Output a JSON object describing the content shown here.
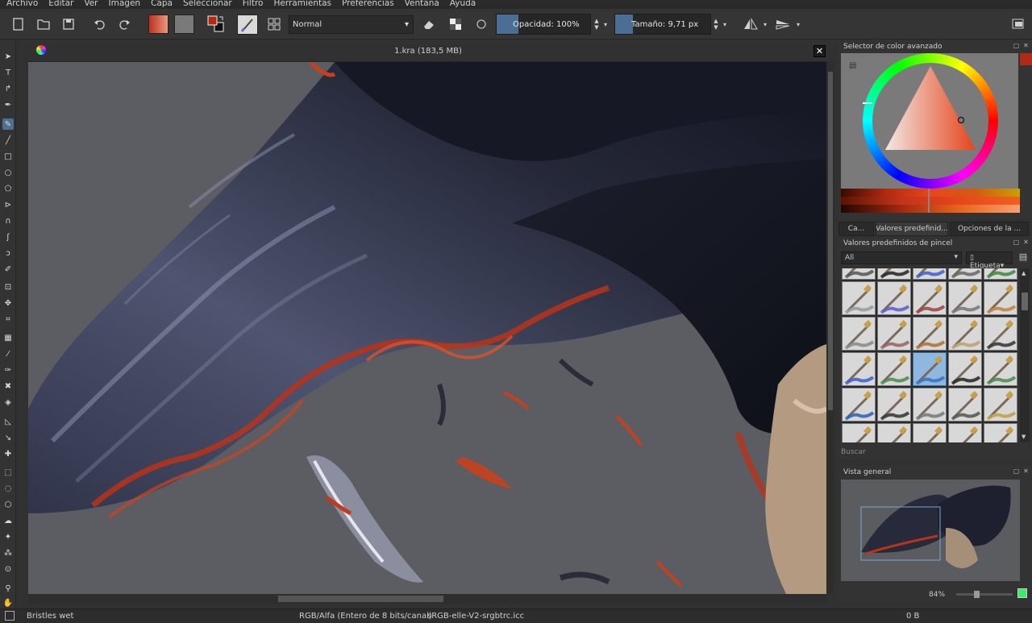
{
  "menu": [
    "Archivo",
    "Editar",
    "Ver",
    "Imagen",
    "Capa",
    "Seleccionar",
    "Filtro",
    "Herramientas",
    "Preferencias",
    "Ventana",
    "Ayuda"
  ],
  "toolbar": {
    "blend_mode": "Normal",
    "opacity_label": "Opacidad:",
    "opacity_value": "100%",
    "opacity_fraction": 0.23,
    "size_label": "Tamaño:",
    "size_value": "9,71 px",
    "size_fraction": 0.19,
    "fg_color": "#b22a14",
    "bg_color": "#111111"
  },
  "document": {
    "title": "1.kra (183,5 MB)"
  },
  "color_selector": {
    "title": "Selector de color avanzado",
    "current_color": "#e4441a"
  },
  "tabs": [
    "Ca...",
    "Valores predefinid...",
    "Opciones de la ..."
  ],
  "brush_presets": {
    "title": "Valores predefinidos de pincel",
    "filter_value": "All",
    "tag_label": "Etiqueta",
    "search_placeholder": "Buscar"
  },
  "overview": {
    "title": "Vista general",
    "zoom": "84%"
  },
  "status": {
    "brush": "Bristles wet",
    "color_model": "RGB/Alfa (Entero de 8 bits/canal)",
    "profile": "sRGB-elle-V2-srgbtrc.icc",
    "memory": "0 B"
  },
  "colors": {
    "accent": "#4a6e94",
    "panel_bg": "#333333"
  }
}
